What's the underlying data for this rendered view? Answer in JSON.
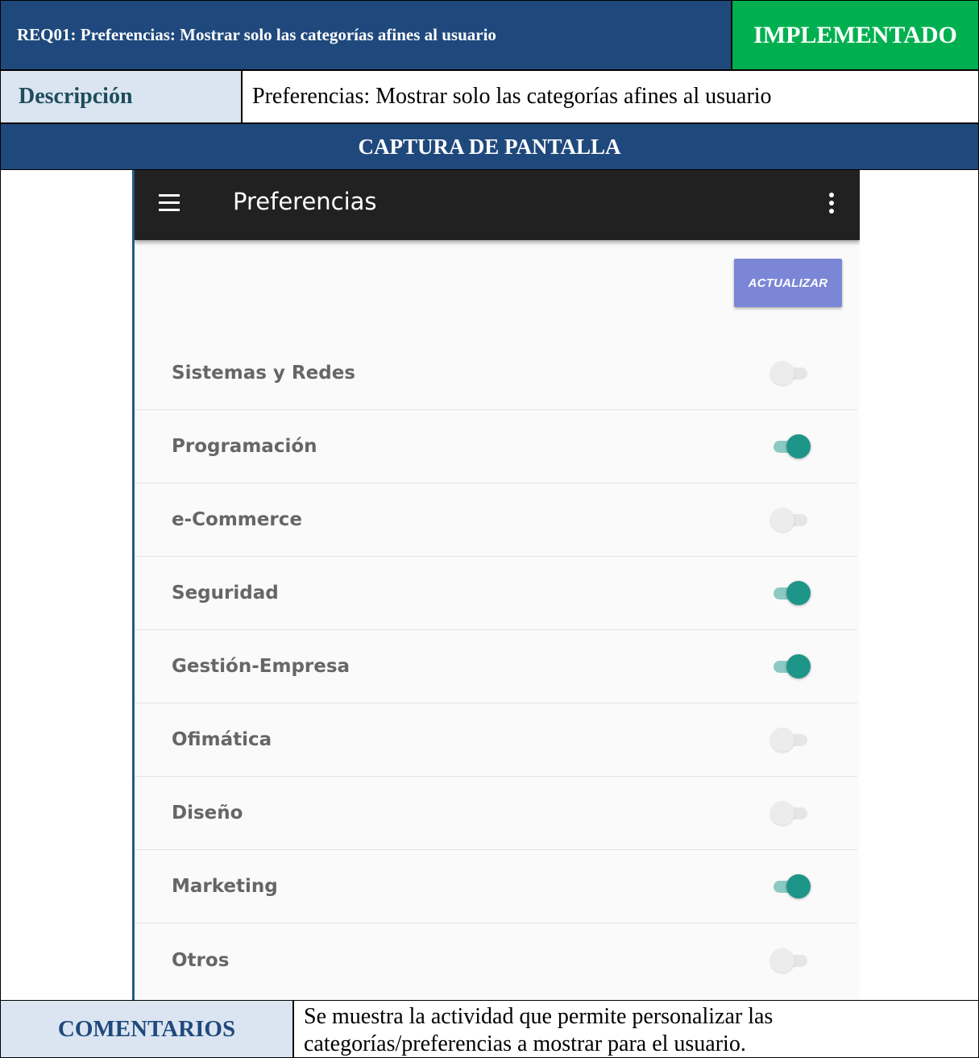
{
  "header": {
    "title": "REQ01: Preferencias: Mostrar solo las categorías afines al usuario",
    "status": "IMPLEMENTADO",
    "status_color": "#00b050"
  },
  "description": {
    "label": "Descripción",
    "value": "Preferencias: Mostrar solo las categorías afines al usuario"
  },
  "screenshot_section": {
    "label": "CAPTURA DE PANTALLA"
  },
  "app": {
    "menu_icon": "hamburger-menu-icon",
    "title": "Preferencias",
    "overflow_icon": "more-vertical-icon",
    "update_button": "ACTUALIZAR",
    "accent_color": "#1e9589",
    "button_color": "#7b86d6",
    "preferences": [
      {
        "label": "Sistemas y Redes",
        "enabled": false
      },
      {
        "label": "Programación",
        "enabled": true
      },
      {
        "label": "e-Commerce",
        "enabled": false
      },
      {
        "label": "Seguridad",
        "enabled": true
      },
      {
        "label": "Gestión-Empresa",
        "enabled": true
      },
      {
        "label": "Ofimática",
        "enabled": false
      },
      {
        "label": "Diseño",
        "enabled": false
      },
      {
        "label": "Marketing",
        "enabled": true
      },
      {
        "label": "Otros",
        "enabled": false
      }
    ]
  },
  "comments": {
    "label": "COMENTARIOS",
    "value": "Se muestra la actividad que permite personalizar las categorías/preferencias a mostrar para el usuario."
  }
}
